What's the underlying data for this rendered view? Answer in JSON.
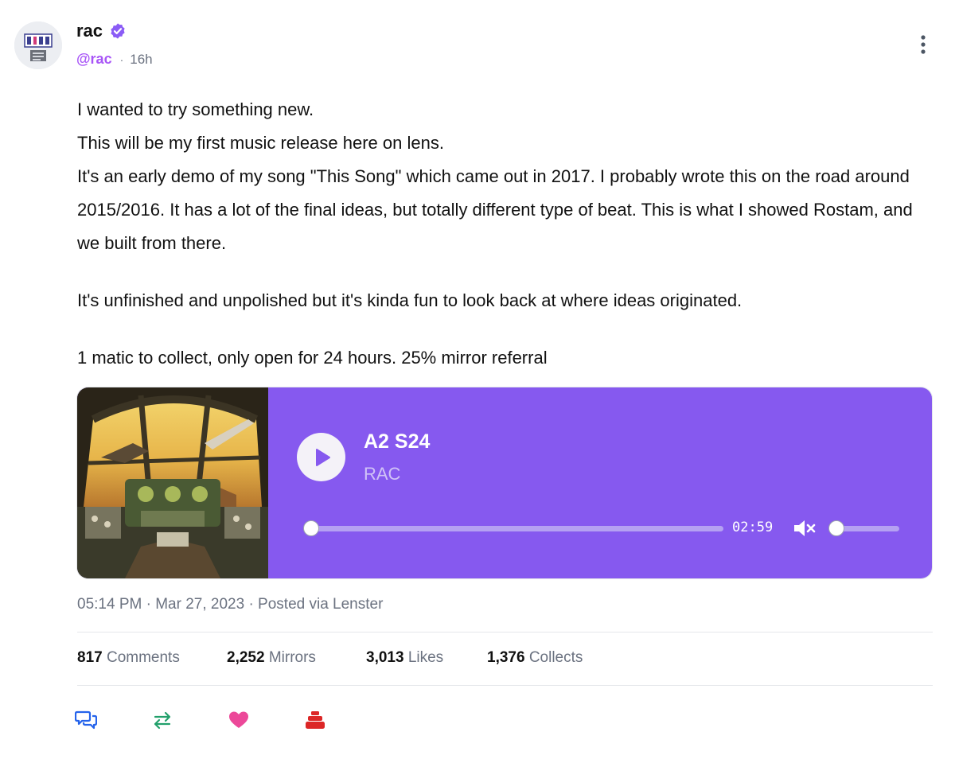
{
  "author": {
    "display_name": "rac",
    "handle": "@rac",
    "time_ago": "16h",
    "separator": "·"
  },
  "post": {
    "lines": [
      "I wanted to try something new.",
      "This will be my first music release here on lens.",
      "It's an early demo of my song \"This Song\" which came out in 2017. I probably wrote this on the road around 2015/2016. It has a lot of the final ideas, but totally different type of beat. This is what I showed Rostam, and we built from there.",
      "It's unfinished and unpolished but it's kinda fun to look back at where ideas originated.",
      "1 matic to collect, only open for 24 hours. 25% mirror referral"
    ]
  },
  "audio": {
    "title": "A2 S24",
    "artist": "RAC",
    "duration": "02:59",
    "progress": 0,
    "volume": 0,
    "muted": true,
    "card_color": "#8659ef"
  },
  "meta": {
    "text": "05:14 PM · Mar 27, 2023 · Posted via Lenster"
  },
  "stats": [
    {
      "count": "817",
      "label": "Comments"
    },
    {
      "count": "2,252",
      "label": "Mirrors"
    },
    {
      "count": "3,013",
      "label": "Likes"
    },
    {
      "count": "1,376",
      "label": "Collects"
    }
  ],
  "actions": [
    {
      "icon": "comment-icon",
      "color": "#2563eb"
    },
    {
      "icon": "mirror-icon",
      "color": "#22a06b"
    },
    {
      "icon": "heart-icon",
      "color": "#ec4899"
    },
    {
      "icon": "collect-icon",
      "color": "#dc2626"
    }
  ],
  "colors": {
    "accent": "#a855f7",
    "verified": "#8b5cf6",
    "muted_text": "#6b7280"
  }
}
